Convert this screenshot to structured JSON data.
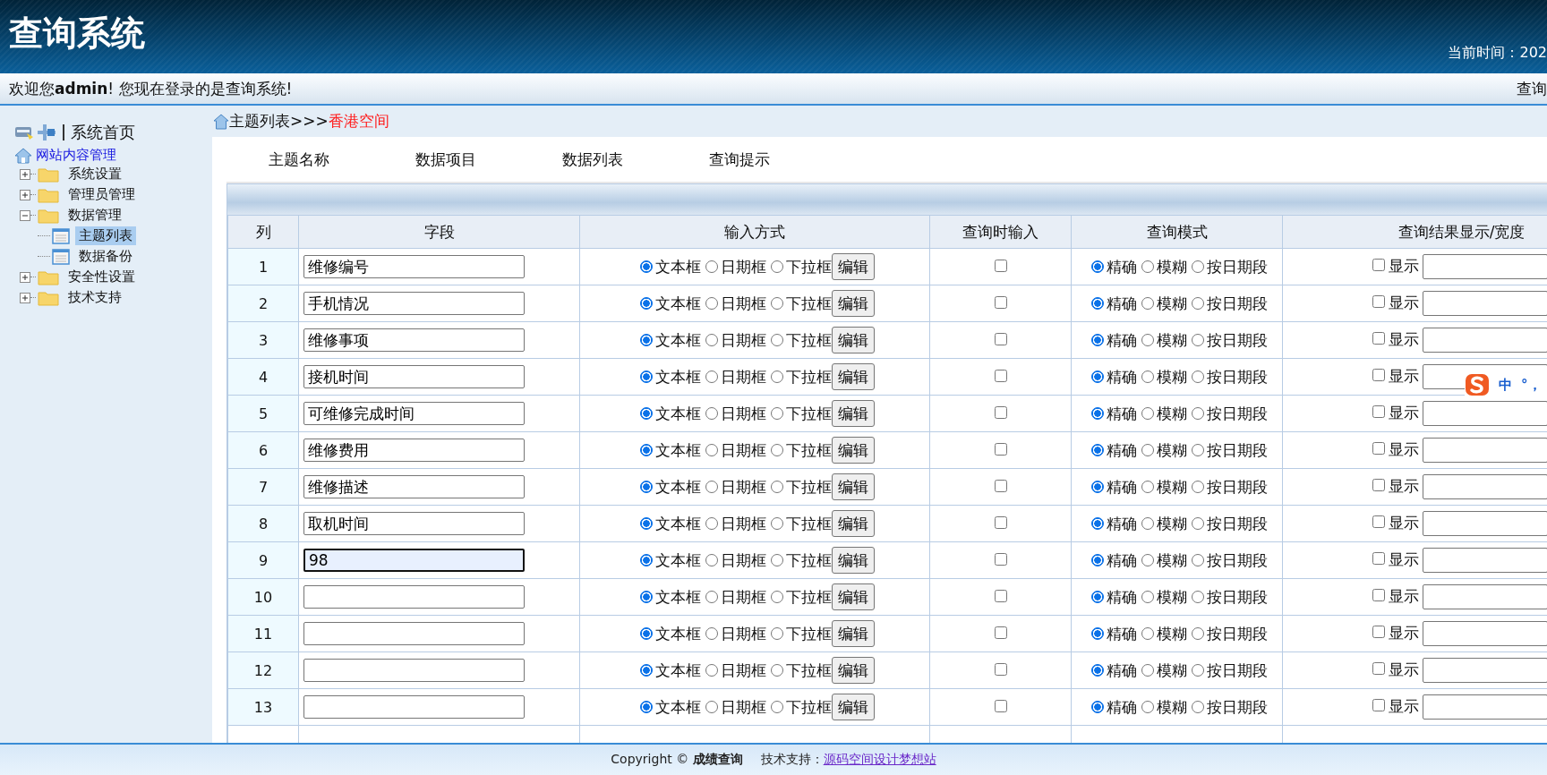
{
  "header": {
    "title": "查询系统",
    "clock": "当前时间：202"
  },
  "welcome": {
    "text": "欢迎您**admin**! 您现在登录的是查询系统!",
    "right": "查询"
  },
  "sidebar": {
    "home": "系统首页",
    "section": "网站内容管理",
    "tree": [
      {
        "label": "系统设置",
        "expanded": false
      },
      {
        "label": "管理员管理",
        "expanded": false
      },
      {
        "label": "数据管理",
        "expanded": true,
        "children": [
          {
            "label": "主题列表",
            "selected": true
          },
          {
            "label": "数据备份",
            "selected": false
          }
        ]
      },
      {
        "label": "安全性设置",
        "expanded": false
      },
      {
        "label": "技术支持",
        "expanded": false
      }
    ]
  },
  "breadcrumb": {
    "path": "主题列表>>>",
    "current": "香港空间"
  },
  "tabs": [
    {
      "label": "主题名称"
    },
    {
      "label": "数据项目"
    },
    {
      "label": "数据列表"
    },
    {
      "label": "查询提示"
    }
  ],
  "table": {
    "columns": [
      "列",
      "字段",
      "输入方式",
      "查询时输入",
      "查询模式",
      "查询结果显示/宽度"
    ],
    "rows": [
      {
        "index": "1",
        "field": "维修编号",
        "focused": false,
        "input_modes": [
          {
            "label": "文本框",
            "selected": true
          },
          {
            "label": "日期框",
            "selected": false
          },
          {
            "label": "下拉框",
            "selected": false
          }
        ],
        "edit": "编辑",
        "query_input": false,
        "match_modes": [
          {
            "label": "精确",
            "selected": true
          },
          {
            "label": "模糊",
            "selected": false
          },
          {
            "label": "按日期段",
            "selected": false
          }
        ],
        "show": false,
        "show_label": "显示"
      },
      {
        "index": "2",
        "field": "手机情况",
        "focused": false,
        "input_modes": [
          {
            "label": "文本框",
            "selected": true
          },
          {
            "label": "日期框",
            "selected": false
          },
          {
            "label": "下拉框",
            "selected": false
          }
        ],
        "edit": "编辑",
        "query_input": false,
        "match_modes": [
          {
            "label": "精确",
            "selected": true
          },
          {
            "label": "模糊",
            "selected": false
          },
          {
            "label": "按日期段",
            "selected": false
          }
        ],
        "show": false,
        "show_label": "显示"
      },
      {
        "index": "3",
        "field": "维修事项",
        "focused": false,
        "input_modes": [
          {
            "label": "文本框",
            "selected": true
          },
          {
            "label": "日期框",
            "selected": false
          },
          {
            "label": "下拉框",
            "selected": false
          }
        ],
        "edit": "编辑",
        "query_input": false,
        "match_modes": [
          {
            "label": "精确",
            "selected": true
          },
          {
            "label": "模糊",
            "selected": false
          },
          {
            "label": "按日期段",
            "selected": false
          }
        ],
        "show": false,
        "show_label": "显示"
      },
      {
        "index": "4",
        "field": "接机时间",
        "focused": false,
        "input_modes": [
          {
            "label": "文本框",
            "selected": true
          },
          {
            "label": "日期框",
            "selected": false
          },
          {
            "label": "下拉框",
            "selected": false
          }
        ],
        "edit": "编辑",
        "query_input": false,
        "match_modes": [
          {
            "label": "精确",
            "selected": true
          },
          {
            "label": "模糊",
            "selected": false
          },
          {
            "label": "按日期段",
            "selected": false
          }
        ],
        "show": false,
        "show_label": "显示"
      },
      {
        "index": "5",
        "field": "可维修完成时间",
        "focused": false,
        "input_modes": [
          {
            "label": "文本框",
            "selected": true
          },
          {
            "label": "日期框",
            "selected": false
          },
          {
            "label": "下拉框",
            "selected": false
          }
        ],
        "edit": "编辑",
        "query_input": false,
        "match_modes": [
          {
            "label": "精确",
            "selected": true
          },
          {
            "label": "模糊",
            "selected": false
          },
          {
            "label": "按日期段",
            "selected": false
          }
        ],
        "show": false,
        "show_label": "显示"
      },
      {
        "index": "6",
        "field": "维修费用",
        "focused": false,
        "input_modes": [
          {
            "label": "文本框",
            "selected": true
          },
          {
            "label": "日期框",
            "selected": false
          },
          {
            "label": "下拉框",
            "selected": false
          }
        ],
        "edit": "编辑",
        "query_input": false,
        "match_modes": [
          {
            "label": "精确",
            "selected": true
          },
          {
            "label": "模糊",
            "selected": false
          },
          {
            "label": "按日期段",
            "selected": false
          }
        ],
        "show": false,
        "show_label": "显示"
      },
      {
        "index": "7",
        "field": "维修描述",
        "focused": false,
        "input_modes": [
          {
            "label": "文本框",
            "selected": true
          },
          {
            "label": "日期框",
            "selected": false
          },
          {
            "label": "下拉框",
            "selected": false
          }
        ],
        "edit": "编辑",
        "query_input": false,
        "match_modes": [
          {
            "label": "精确",
            "selected": true
          },
          {
            "label": "模糊",
            "selected": false
          },
          {
            "label": "按日期段",
            "selected": false
          }
        ],
        "show": false,
        "show_label": "显示"
      },
      {
        "index": "8",
        "field": "取机时间",
        "focused": false,
        "input_modes": [
          {
            "label": "文本框",
            "selected": true
          },
          {
            "label": "日期框",
            "selected": false
          },
          {
            "label": "下拉框",
            "selected": false
          }
        ],
        "edit": "编辑",
        "query_input": false,
        "match_modes": [
          {
            "label": "精确",
            "selected": true
          },
          {
            "label": "模糊",
            "selected": false
          },
          {
            "label": "按日期段",
            "selected": false
          }
        ],
        "show": false,
        "show_label": "显示"
      },
      {
        "index": "9",
        "field": "98",
        "focused": true,
        "input_modes": [
          {
            "label": "文本框",
            "selected": true
          },
          {
            "label": "日期框",
            "selected": false
          },
          {
            "label": "下拉框",
            "selected": false
          }
        ],
        "edit": "编辑",
        "query_input": false,
        "match_modes": [
          {
            "label": "精确",
            "selected": true
          },
          {
            "label": "模糊",
            "selected": false
          },
          {
            "label": "按日期段",
            "selected": false
          }
        ],
        "show": false,
        "show_label": "显示"
      },
      {
        "index": "10",
        "focused": false,
        "input_modes": [
          {
            "label": "文本框",
            "selected": true
          },
          {
            "label": "日期框",
            "selected": false
          },
          {
            "label": "下拉框",
            "selected": false
          }
        ],
        "edit": "编辑",
        "query_input": false,
        "match_modes": [
          {
            "label": "精确",
            "selected": true
          },
          {
            "label": "模糊",
            "selected": false
          },
          {
            "label": "按日期段",
            "selected": false
          }
        ],
        "show": false,
        "show_label": "显示"
      },
      {
        "index": "11",
        "focused": false,
        "input_modes": [
          {
            "label": "文本框",
            "selected": true
          },
          {
            "label": "日期框",
            "selected": false
          },
          {
            "label": "下拉框",
            "selected": false
          }
        ],
        "edit": "编辑",
        "query_input": false,
        "match_modes": [
          {
            "label": "精确",
            "selected": true
          },
          {
            "label": "模糊",
            "selected": false
          },
          {
            "label": "按日期段",
            "selected": false
          }
        ],
        "show": false,
        "show_label": "显示"
      },
      {
        "index": "12",
        "focused": false,
        "input_modes": [
          {
            "label": "文本框",
            "selected": true
          },
          {
            "label": "日期框",
            "selected": false
          },
          {
            "label": "下拉框",
            "selected": false
          }
        ],
        "edit": "编辑",
        "query_input": false,
        "match_modes": [
          {
            "label": "精确",
            "selected": true
          },
          {
            "label": "模糊",
            "selected": false
          },
          {
            "label": "按日期段",
            "selected": false
          }
        ],
        "show": false,
        "show_label": "显示"
      },
      {
        "index": "13",
        "focused": false,
        "input_modes": [
          {
            "label": "文本框",
            "selected": true
          },
          {
            "label": "日期框",
            "selected": false
          },
          {
            "label": "下拉框",
            "selected": false
          }
        ],
        "edit": "编辑",
        "query_input": false,
        "match_modes": [
          {
            "label": "精确",
            "selected": true
          },
          {
            "label": "模糊",
            "selected": false
          },
          {
            "label": "按日期段",
            "selected": false
          }
        ],
        "show": false,
        "show_label": "显示"
      }
    ]
  },
  "ime": {
    "mode": "中",
    "punct": "°，"
  },
  "footer": {
    "copyright": "Copyright ©  **成绩查询**",
    "support_label": "技术支持：",
    "support_link": "源码空间设计梦想站"
  }
}
